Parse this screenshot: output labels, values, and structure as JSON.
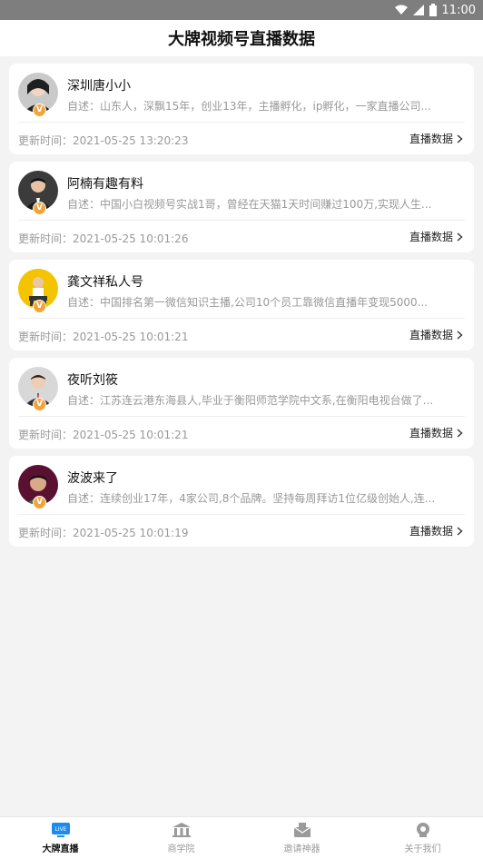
{
  "status_bar": {
    "time": "11:00"
  },
  "header": {
    "title": "大牌视频号直播数据"
  },
  "cards": [
    {
      "name": "深圳唐小小",
      "desc": "自述：山东人，深飘15年，创业13年，主播孵化，ip孵化，一家直播公司...",
      "updated": "更新时间：2021-05-25 13:20:23",
      "link": "直播数据"
    },
    {
      "name": "阿楠有趣有料",
      "desc": "自述：中国小白视频号实战1哥，曾经在天猫1天时间赚过100万,实现人生...",
      "updated": "更新时间：2021-05-25 10:01:26",
      "link": "直播数据"
    },
    {
      "name": "龚文祥私人号",
      "desc": "自述：中国排名第一微信知识主播,公司10个员工靠微信直播年变现5000...",
      "updated": "更新时间：2021-05-25 10:01:21",
      "link": "直播数据"
    },
    {
      "name": "夜听刘筱",
      "desc": "自述：江苏连云港东海县人,毕业于衡阳师范学院中文系,在衡阳电视台做了...",
      "updated": "更新时间：2021-05-25 10:01:21",
      "link": "直播数据"
    },
    {
      "name": "波波来了",
      "desc": "自述：连续创业17年，4家公司,8个品牌。坚持每周拜访1位亿级创始人,连...",
      "updated": "更新时间：2021-05-25 10:01:19",
      "link": "直播数据"
    }
  ],
  "badge_text": "V",
  "tabs": [
    {
      "label": "大牌直播",
      "icon": "live-icon",
      "active": true,
      "icon_text": "LIVE"
    },
    {
      "label": "商学院",
      "icon": "academy-icon",
      "active": false
    },
    {
      "label": "邀请神器",
      "icon": "invite-icon",
      "active": false
    },
    {
      "label": "关于我们",
      "icon": "about-icon",
      "active": false
    }
  ],
  "colors": {
    "accent": "#1a8cf0",
    "badge": "#f2a43a",
    "muted": "#999999",
    "background": "#f3f3f3"
  }
}
